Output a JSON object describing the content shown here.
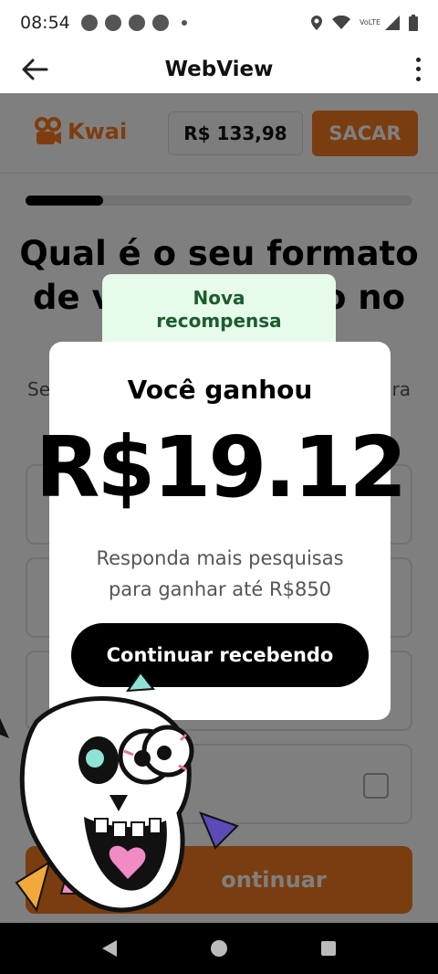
{
  "status_bar": {
    "time": "08:54",
    "network_label": "VoLTE"
  },
  "app_bar": {
    "title": "WebView"
  },
  "page": {
    "brand": "Kwai",
    "balance": "R$ 133,98",
    "withdraw_label": "SACAR",
    "progress_fraction": 0.2,
    "question_visible_line1": "Qual é o seu formato",
    "question_visible_line2_left": "de v",
    "question_visible_line2_right": "o no",
    "subtext_left": "Se",
    "subtext_right": "ra",
    "continue_label": "ontinuar"
  },
  "modal": {
    "tab_label_line1": "Nova",
    "tab_label_line2": "recompensa",
    "heading": "Você ganhou",
    "amount": "R$19.12",
    "description_line1": "Responda mais pesquisas",
    "description_line2": "para ganhar até R$850",
    "button_label": "Continuar recebendo"
  },
  "colors": {
    "brand_orange": "#f57a1f",
    "tab_green_bg": "#e6fbe9",
    "tab_green_text": "#1d5c2e"
  },
  "icons": [
    "back-arrow-icon",
    "more-vert-icon",
    "location-icon",
    "wifi-icon",
    "signal-icon",
    "battery-icon",
    "nav-back-icon",
    "nav-home-icon",
    "nav-recent-icon"
  ]
}
